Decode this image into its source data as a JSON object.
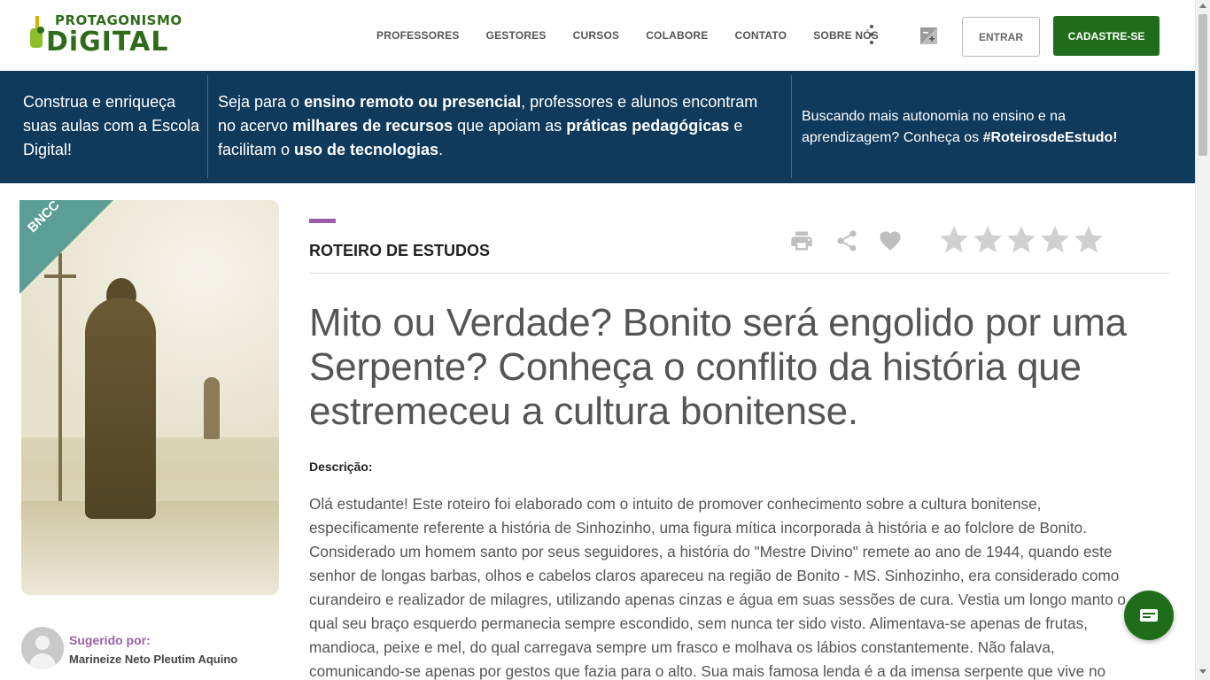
{
  "logo": {
    "line1": "PROTAGONISMO",
    "line2": "DiGITAL"
  },
  "nav": {
    "items": [
      "PROFESSORES",
      "GESTORES",
      "CURSOS",
      "COLABORE",
      "CONTATO",
      "SOBRE NÓS"
    ]
  },
  "header": {
    "login_label": "ENTRAR",
    "signup_label": "CADASTRE-SE"
  },
  "banner": {
    "col1": "Construa e enriqueça suas aulas com a Escola Digital!",
    "col2": {
      "t1": "Seja para o ",
      "b1": "ensino remoto ou presencial",
      "t2": ", professores e alunos encontram no acervo ",
      "b2": "milhares de recursos",
      "t3": " que apoiam as ",
      "b3": "práticas pedagógicas",
      "t4": " e facilitam o ",
      "b4": "uso de tecnologias",
      "t5": "."
    },
    "col3": {
      "t1": "Buscando mais autonomia no ensino e na aprendizagem? Conheça os ",
      "b1": "#RoteirosdeEstudo!"
    }
  },
  "resource": {
    "badge": "BNCC",
    "section": "ROTEIRO DE ESTUDOS",
    "title": "Mito ou Verdade? Bonito será engolido por uma Serpente? Conheça o conflito da história que estremeceu a cultura bonitense.",
    "description_label": "Descrição:",
    "description": "Olá estudante! Este roteiro foi elaborado com o intuito de promover conhecimento sobre a cultura bonitense, especificamente referente a história de Sinhozinho, uma figura mítica incorporada à história e ao folclore de Bonito. Considerado um homem santo por seus seguidores, a história do \"Mestre Divino\" remete ao ano de 1944, quando este senhor de longas barbas, olhos e cabelos claros apareceu na região de Bonito - MS. Sinhozinho, era considerado como curandeiro e realizador de milagres, utilizando apenas cinzas e água em suas sessões de cura. Vestia um longo manto o qual seu braço esquerdo permanecia sempre escondido, sem nunca ter sido visto. Alimentava-se apenas de frutas, mandioca, peixe e mel, do qual carregava sempre um frasco e molhava os lábios constantemente. Não falava, comunicando-se apenas por gestos que fazia para o alto. Sua mais famosa lenda é a da imensa serpente que vive no",
    "rating": 0,
    "rating_max": 5
  },
  "suggested": {
    "label": "Sugerido por:",
    "name": "Marineize Neto Pleutim Aquino"
  },
  "icons": {
    "print": "print-icon",
    "share": "share-icon",
    "favorite": "heart-icon",
    "star": "star-icon",
    "contrast": "contrast-icon",
    "more": "kebab-menu-icon",
    "fab": "slideshow-icon"
  },
  "colors": {
    "primary_green": "#1f6d1a",
    "banner_blue": "#103a5c",
    "accent_purple": "#9b5ea8",
    "bncc_teal": "#5a9e96",
    "icon_gray": "#bfbfbf"
  }
}
